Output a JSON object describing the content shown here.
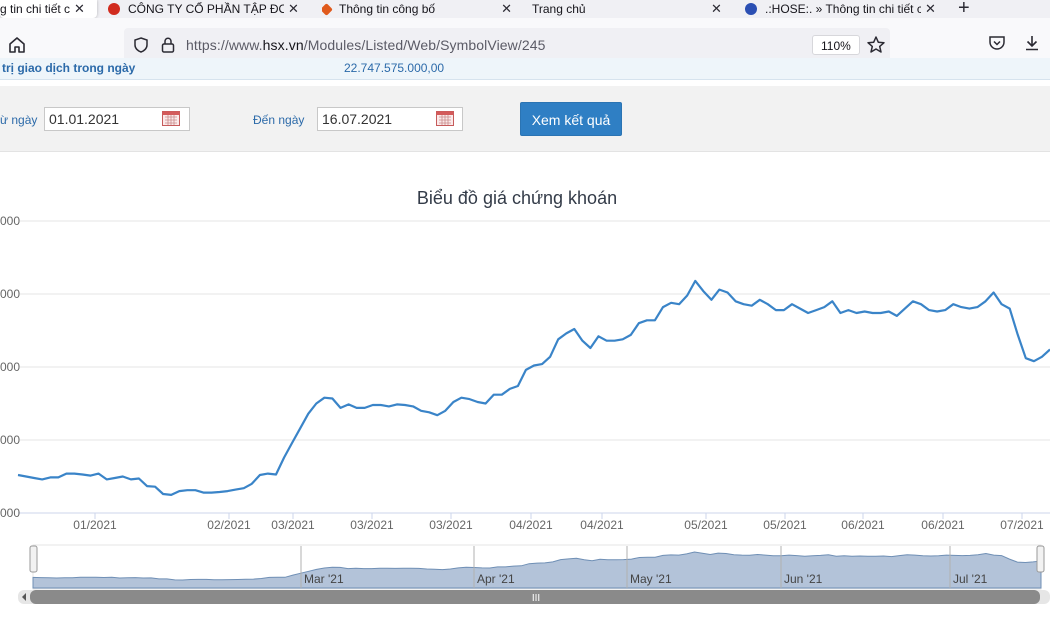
{
  "browser": {
    "tabs": [
      {
        "title": "g tin chi tiết c",
        "active": true,
        "favicon_color": ""
      },
      {
        "title": "CÔNG TY CỔ PHẦN TẬP ĐOÀ",
        "active": false,
        "favicon_color": "#d12b1e"
      },
      {
        "title": "Thông tin công bố",
        "active": false,
        "favicon_color": "#e05a1c"
      },
      {
        "title": "Trang chủ",
        "active": false,
        "favicon_color": ""
      },
      {
        "title": ".:HOSE:. » Thông tin chi tiết c",
        "active": false,
        "favicon_color": "#2b4fb3"
      }
    ],
    "new_tab": "+",
    "url": {
      "prefix": "https://www.",
      "host": "hsx.vn",
      "path": "/Modules/Listed/Web/SymbolView/245"
    },
    "zoom": "110%"
  },
  "stats": {
    "label": "trị giao dịch trong ngày",
    "value": "22.747.575.000,00"
  },
  "filter": {
    "from_label": "ừ ngày",
    "from_value": "01.01.2021",
    "to_label": "Đến ngày",
    "to_value": "16.07.2021",
    "submit_label": "Xem kết quả"
  },
  "chart_data": {
    "type": "line",
    "title": "Biểu đồ giá chứng khoán",
    "color": "#3a84c8",
    "y_tick_labels": [
      "000",
      "000",
      "000",
      "000",
      "000"
    ],
    "x_tick_labels": [
      "01/2021",
      "02/2021",
      "03/2021",
      "03/2021",
      "03/2021",
      "04/2021",
      "04/2021",
      "05/2021",
      "05/2021",
      "06/2021",
      "06/2021",
      "07/2021"
    ],
    "navigator_labels": [
      "Mar '21",
      "Apr '21",
      "May '21",
      "Jun '21",
      "Jul '21"
    ],
    "scrollbar_grip": "III",
    "y_axis_note": "y-axis tick values are cropped at the left edge; only trailing digits visible",
    "y": [
      -2.7,
      -2.75,
      -2.8,
      -2.85,
      -2.78,
      -2.78,
      -2.65,
      -2.65,
      -2.68,
      -2.72,
      -2.65,
      -2.85,
      -2.8,
      -2.75,
      -2.85,
      -2.82,
      -3.08,
      -3.1,
      -3.35,
      -3.38,
      -3.25,
      -3.22,
      -3.22,
      -3.3,
      -3.3,
      -3.28,
      -3.25,
      -3.2,
      -3.15,
      -3.0,
      -2.7,
      -2.65,
      -2.68,
      -2.1,
      -1.6,
      -1.1,
      -0.6,
      -0.25,
      -0.05,
      -0.08,
      -0.4,
      -0.28,
      -0.4,
      -0.4,
      -0.3,
      -0.3,
      -0.35,
      -0.28,
      -0.3,
      -0.35,
      -0.5,
      -0.55,
      -0.65,
      -0.5,
      -0.2,
      -0.05,
      -0.1,
      -0.2,
      -0.25,
      0.05,
      0.05,
      0.25,
      0.35,
      0.9,
      1.05,
      1.1,
      1.35,
      1.95,
      2.15,
      2.3,
      1.9,
      1.65,
      2.05,
      1.9,
      1.9,
      1.95,
      2.1,
      2.5,
      2.6,
      2.6,
      3.05,
      3.2,
      3.15,
      3.45,
      3.95,
      3.6,
      3.3,
      3.65,
      3.55,
      3.25,
      3.15,
      3.1,
      3.3,
      3.15,
      2.95,
      2.95,
      3.15,
      3.0,
      2.85,
      2.95,
      3.05,
      3.25,
      2.85,
      2.95,
      2.85,
      2.9,
      2.85,
      2.85,
      2.9,
      2.75,
      3.0,
      3.25,
      3.15,
      2.95,
      2.9,
      2.95,
      3.15,
      3.05,
      3.0,
      3.05,
      3.25,
      3.55,
      3.15,
      3.0,
      2.1,
      1.3,
      1.2,
      1.35,
      1.6
    ]
  }
}
